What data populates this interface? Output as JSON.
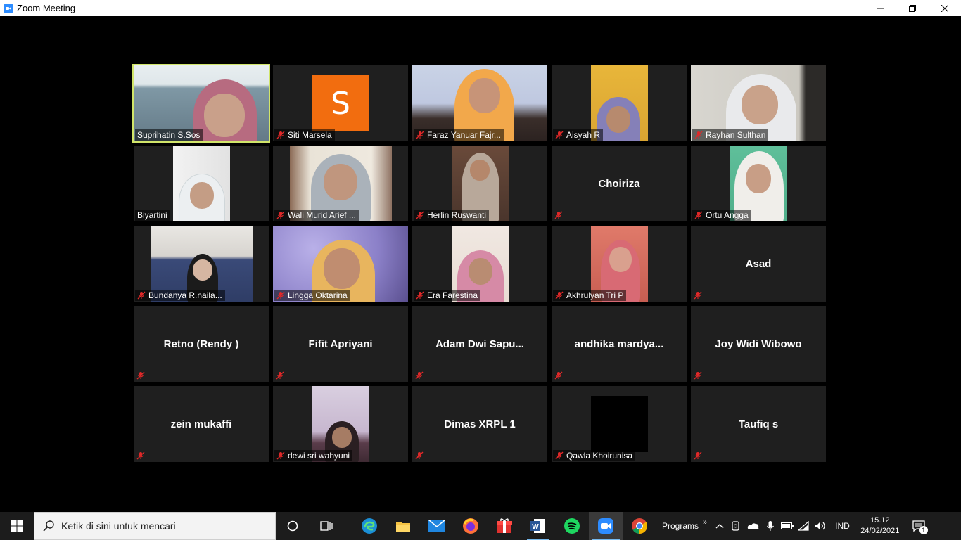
{
  "window": {
    "title": "Zoom Meeting",
    "controls": [
      "minimize",
      "restore",
      "close"
    ]
  },
  "participants": [
    {
      "name": "Suprihatin S.Sos",
      "video": true,
      "muted": false,
      "active_speaker": true
    },
    {
      "name": "Siti Marsela",
      "video": false,
      "avatar_letter": "S",
      "avatar_color": "#f26d0f",
      "muted": true
    },
    {
      "name": "Faraz Yanuar Fajr...",
      "video": true,
      "muted": true
    },
    {
      "name": "Aisyah R",
      "video": true,
      "muted": true
    },
    {
      "name": "Rayhan Sulthan",
      "video": true,
      "muted": true
    },
    {
      "name": "Biyartini",
      "video": true,
      "muted": false
    },
    {
      "name": "Wali Murid Arief ...",
      "video": true,
      "muted": true
    },
    {
      "name": "Herlin Ruswanti",
      "video": true,
      "muted": true
    },
    {
      "name": "Choiriza",
      "video": false,
      "muted": true
    },
    {
      "name": "Ortu Angga",
      "video": true,
      "muted": true
    },
    {
      "name": "Bundanya R.naila...",
      "video": true,
      "muted": true
    },
    {
      "name": "Lingga Oktarina",
      "video": true,
      "muted": true
    },
    {
      "name": "Era Farestina",
      "video": true,
      "muted": true
    },
    {
      "name": "Akhrulyan Tri P",
      "video": true,
      "muted": true
    },
    {
      "name": "Asad",
      "video": false,
      "muted": true
    },
    {
      "name": "Retno (Rendy )",
      "video": false,
      "muted": true
    },
    {
      "name": "Fifit Apriyani",
      "video": false,
      "muted": true
    },
    {
      "name": "Adam  Dwi Sapu...",
      "video": false,
      "muted": true
    },
    {
      "name": "andhika  mardya...",
      "video": false,
      "muted": true
    },
    {
      "name": "Joy Widi Wibowo",
      "video": false,
      "muted": true
    },
    {
      "name": "zein mukaffi",
      "video": false,
      "muted": true
    },
    {
      "name": "dewi sri wahyuni",
      "video": true,
      "muted": true
    },
    {
      "name": "Dimas XRPL 1",
      "video": false,
      "muted": true
    },
    {
      "name": "Qawla Khoirunisa",
      "video": true,
      "muted": true
    },
    {
      "name": "Taufiq s",
      "video": false,
      "muted": true
    }
  ],
  "taskbar": {
    "search_placeholder": "Ketik di sini untuk mencari",
    "apps": [
      "edge-icon",
      "file-explorer-icon",
      "mail-icon",
      "firefox-icon",
      "gift-icon",
      "word-icon",
      "spotify-icon",
      "zoom-icon",
      "chrome-icon"
    ],
    "programs_label": "Programs",
    "language": "IND",
    "time": "15.12",
    "date": "24/02/2021",
    "notification_count": "1"
  },
  "colors": {
    "active_speaker_border": "#d1e56a",
    "tile_bg": "#1f1f1f",
    "mute_red": "#e02828",
    "accent_blue": "#2d8cff"
  }
}
